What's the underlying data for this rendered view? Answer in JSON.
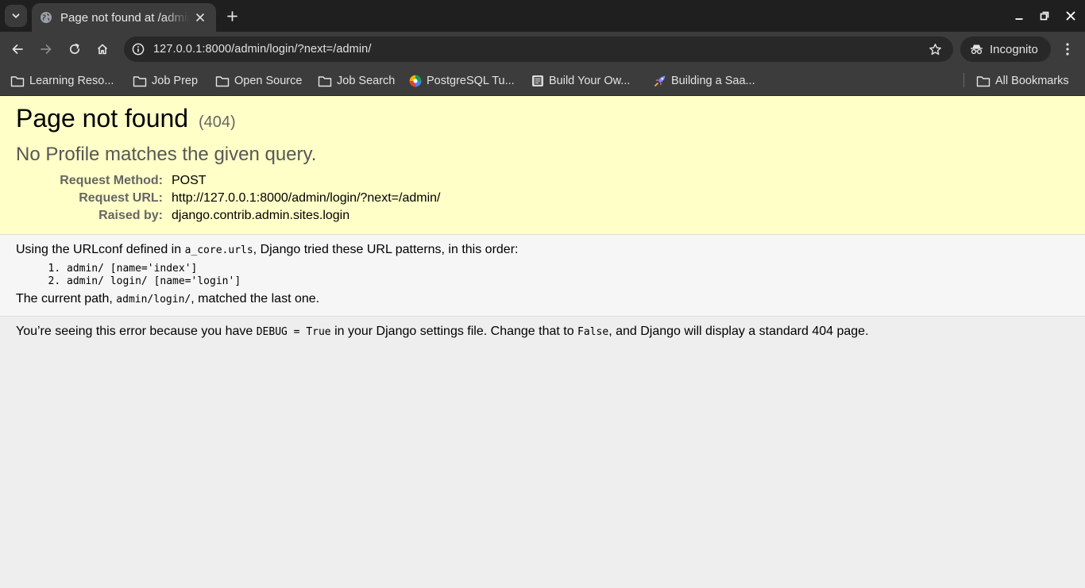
{
  "browser": {
    "tab": {
      "title": "Page not found at /admin/login/"
    },
    "address_bar": {
      "url": "127.0.0.1:8000/admin/login/?next=/admin/"
    },
    "profile_label": "Incognito",
    "bookmarks": [
      {
        "label": "Learning Reso...",
        "icon": "folder-icon"
      },
      {
        "label": "Job Prep",
        "icon": "folder-icon"
      },
      {
        "label": "Open Source",
        "icon": "folder-icon"
      },
      {
        "label": "Job Search",
        "icon": "folder-icon"
      },
      {
        "label": "PostgreSQL Tu...",
        "icon": "postgres-favicon"
      },
      {
        "label": "Build Your Ow...",
        "icon": "book-favicon"
      },
      {
        "label": "Building a Saa...",
        "icon": "rocket-favicon"
      }
    ],
    "all_bookmarks_label": "All Bookmarks"
  },
  "error_page": {
    "title": "Page not found",
    "status_code": "(404)",
    "exception_message": "No Profile matches the given query.",
    "meta": [
      {
        "label": "Request Method:",
        "value": "POST"
      },
      {
        "label": "Request URL:",
        "value": "http://127.0.0.1:8000/admin/login/?next=/admin/"
      },
      {
        "label": "Raised by:",
        "value": "django.contrib.admin.sites.login"
      }
    ],
    "urlconf": {
      "prefix": "Using the URLconf defined in ",
      "module": "a_core.urls",
      "suffix": ", Django tried these URL patterns, in this order:"
    },
    "patterns": [
      "admin/ [name='index']",
      "admin/ login/ [name='login']"
    ],
    "current_path": {
      "prefix": "The current path, ",
      "path": "admin/login/",
      "suffix": ", matched the last one."
    },
    "explanation": {
      "part1": "You’re seeing this error because you have ",
      "code1": "DEBUG = True",
      "part2": " in your Django settings file. Change that to ",
      "code2": "False",
      "part3": ", and Django will display a standard 404 page."
    }
  },
  "colors": {
    "summary_bg": "#ffffc8",
    "info_bg": "#f6f6f6",
    "page_bg": "#eeeeee",
    "chrome_dark": "#1f1f1f",
    "chrome_toolbar": "#3c3c3c"
  }
}
